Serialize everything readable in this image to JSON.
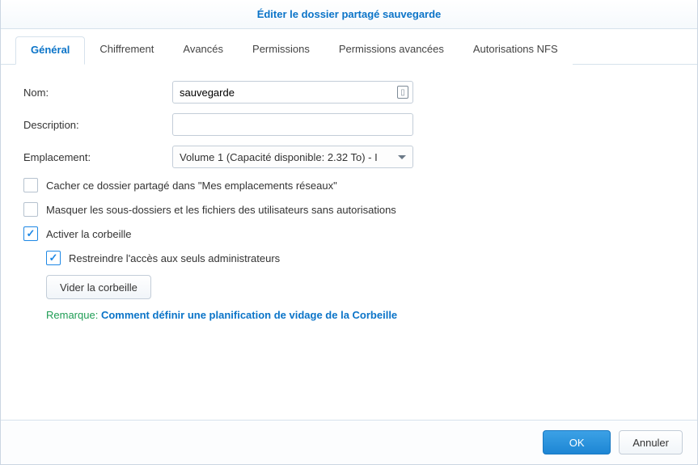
{
  "dialog": {
    "title": "Éditer le dossier partagé sauvegarde"
  },
  "tabs": {
    "general": "Général",
    "encryption": "Chiffrement",
    "advanced": "Avancés",
    "permissions": "Permissions",
    "adv_permissions": "Permissions avancées",
    "nfs": "Autorisations NFS"
  },
  "form": {
    "name_label": "Nom:",
    "name_value": "sauvegarde",
    "description_label": "Description:",
    "description_value": "",
    "location_label": "Emplacement:",
    "location_selected": "Volume 1 (Capacité disponible: 2.32 To) - I"
  },
  "options": {
    "hide_in_network": "Cacher ce dossier partagé dans \"Mes emplacements réseaux\"",
    "hide_unauth": "Masquer les sous-dossiers et les fichiers des utilisateurs sans autorisations",
    "enable_trash": "Activer la corbeille",
    "restrict_admin": "Restreindre l'accès aux seuls administrateurs",
    "empty_trash_btn": "Vider la corbeille"
  },
  "remark": {
    "label": "Remarque:",
    "link": "Comment définir une planification de vidage de la Corbeille"
  },
  "footer": {
    "ok": "OK",
    "cancel": "Annuler"
  }
}
